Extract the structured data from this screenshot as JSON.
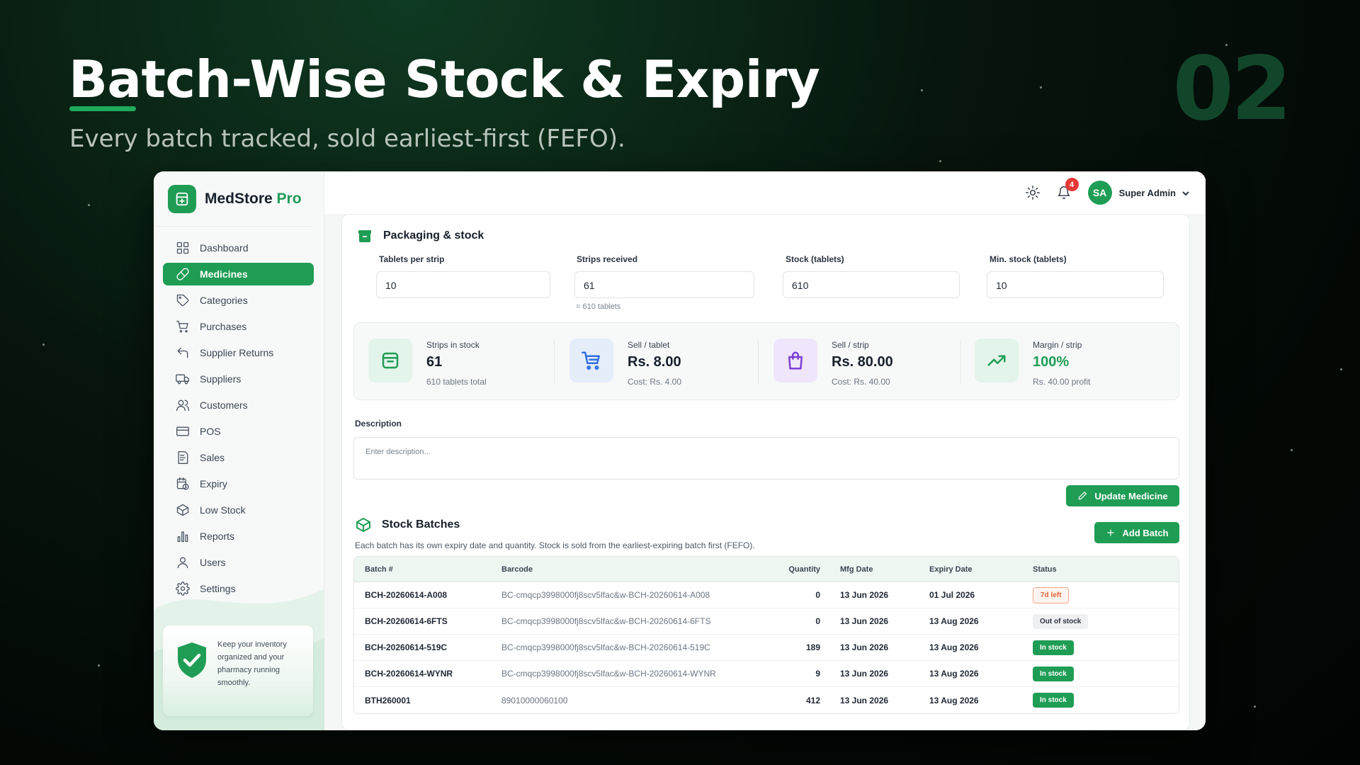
{
  "hero": {
    "title": "Batch-Wise Stock & Expiry",
    "subtitle": "Every batch tracked, sold earliest-first (FEFO).",
    "slide_number": "02"
  },
  "brand": {
    "name": "MedStore",
    "suffix": "Pro"
  },
  "sidebar": {
    "items": [
      {
        "label": "Dashboard",
        "icon": "dashboard-icon"
      },
      {
        "label": "Medicines",
        "icon": "pill-icon",
        "active": true
      },
      {
        "label": "Categories",
        "icon": "tag-icon"
      },
      {
        "label": "Purchases",
        "icon": "cart-icon"
      },
      {
        "label": "Supplier Returns",
        "icon": "return-icon"
      },
      {
        "label": "Suppliers",
        "icon": "truck-icon"
      },
      {
        "label": "Customers",
        "icon": "users-icon"
      },
      {
        "label": "POS",
        "icon": "card-icon"
      },
      {
        "label": "Sales",
        "icon": "receipt-icon"
      },
      {
        "label": "Expiry",
        "icon": "calendar-clock-icon"
      },
      {
        "label": "Low Stock",
        "icon": "box-icon"
      },
      {
        "label": "Reports",
        "icon": "bar-chart-icon"
      },
      {
        "label": "Users",
        "icon": "user-icon"
      },
      {
        "label": "Settings",
        "icon": "gear-icon"
      }
    ],
    "promo_text": "Keep your inventory organized and your pharmacy running smoothly."
  },
  "topbar": {
    "notification_count": "4",
    "user_initials": "SA",
    "user_name": "Super Admin"
  },
  "packaging": {
    "title": "Packaging & stock",
    "fields": [
      {
        "label": "Tablets per strip",
        "value": "10"
      },
      {
        "label": "Strips received",
        "value": "61"
      },
      {
        "label": "Stock (tablets)",
        "value": "610"
      },
      {
        "label": "Min. stock (tablets)",
        "value": "10"
      }
    ],
    "strips_hint": "= 610 tablets"
  },
  "stats": [
    {
      "label": "Strips in stock",
      "value": "61",
      "sub": "610 tablets total",
      "icon": "box-icon",
      "accent": "#1f9d55"
    },
    {
      "label": "Sell / tablet",
      "value": "Rs. 8.00",
      "sub": "Cost: Rs. 4.00",
      "icon": "cart-icon",
      "accent": "#2f6fe0"
    },
    {
      "label": "Sell / strip",
      "value": "Rs. 80.00",
      "sub": "Cost: Rs. 40.00",
      "icon": "bag-icon",
      "accent": "#7b3fd6"
    },
    {
      "label": "Margin / strip",
      "value": "100%",
      "sub": "Rs. 40.00 profit",
      "icon": "trend-up-icon",
      "accent": "#1f9d55"
    }
  ],
  "description": {
    "label": "Description",
    "placeholder": "Enter description..."
  },
  "buttons": {
    "update": "Update Medicine",
    "add_batch": "Add Batch"
  },
  "batches": {
    "title": "Stock Batches",
    "subtitle": "Each batch has its own expiry date and quantity. Stock is sold from the earliest-expiring batch first (FEFO).",
    "columns": [
      "Batch #",
      "Barcode",
      "Quantity",
      "Mfg Date",
      "Expiry Date",
      "Status"
    ],
    "rows": [
      {
        "batch": "BCH-20260614-A008",
        "barcode": "BC-cmqcp3998000fj8scv5lfac&w-BCH-20260614-A008",
        "qty": "0",
        "mfg": "13 Jun 2026",
        "expiry": "01 Jul 2026",
        "status": "7d left",
        "status_type": "expire"
      },
      {
        "batch": "BCH-20260614-6FTS",
        "barcode": "BC-cmqcp3998000fj8scv5lfac&w-BCH-20260614-6FTS",
        "qty": "0",
        "mfg": "13 Jun 2026",
        "expiry": "13 Aug 2026",
        "status": "Out of stock",
        "status_type": "out"
      },
      {
        "batch": "BCH-20260614-519C",
        "barcode": "BC-cmqcp3998000fj8scv5lfac&w-BCH-20260614-519C",
        "qty": "189",
        "mfg": "13 Jun 2026",
        "expiry": "13 Aug 2026",
        "status": "In stock",
        "status_type": "in"
      },
      {
        "batch": "BCH-20260614-WYNR",
        "barcode": "BC-cmqcp3998000fj8scv5lfac&w-BCH-20260614-WYNR",
        "qty": "9",
        "mfg": "13 Jun 2026",
        "expiry": "13 Aug 2026",
        "status": "In stock",
        "status_type": "in"
      },
      {
        "batch": "BTH260001",
        "barcode": "89010000060100",
        "qty": "412",
        "mfg": "13 Jun 2026",
        "expiry": "13 Aug 2026",
        "status": "In stock",
        "status_type": "in"
      }
    ]
  }
}
